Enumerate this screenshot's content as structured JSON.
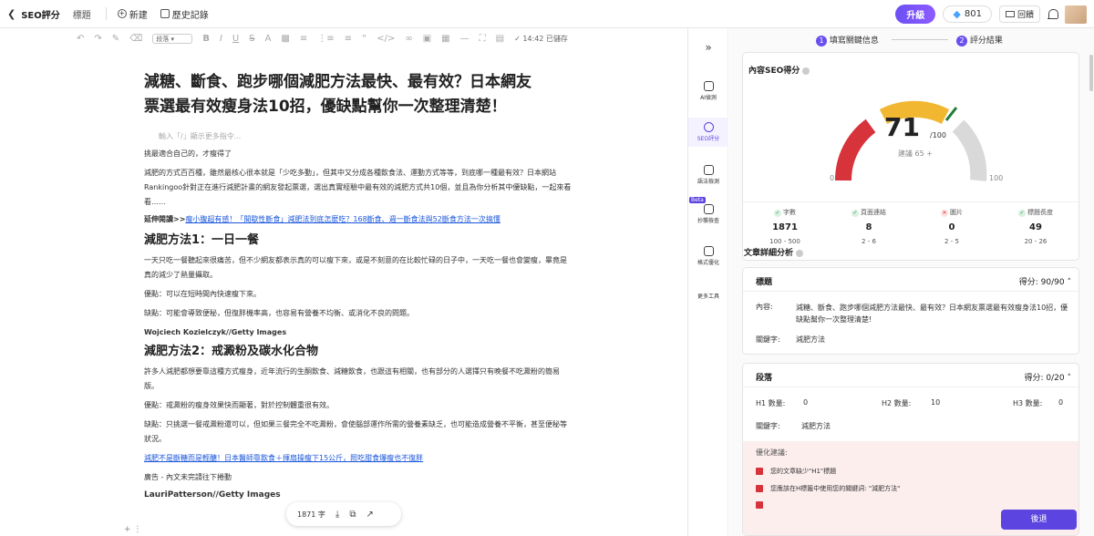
{
  "topbar": {
    "seo_label": "SEO評分",
    "title_label": "標題",
    "new_label": "新建",
    "history_label": "歷史記錄",
    "upgrade_label": "升級",
    "points": "801",
    "reply_label": "回饋"
  },
  "toolbar": {
    "paragraph_label": "段落",
    "saved_label": "14:42 已儲存"
  },
  "doc": {
    "title": "減糖、斷食、跑步哪個減肥方法最快、最有效？日本網友票選最有效瘦身法10招，優缺點幫你一次整理清楚！",
    "command_placeholder": "輸入「/」顯示更多指令...",
    "p1": "挑最適合自己的，才瘦得了",
    "p2": "減肥的方式百百種，雖然最核心很本就是「少吃多動」，但其中又分成各種飲食法、運動方式等等，到底哪一種最有效？日本網站Rankingoo針對正在進行減肥計畫的網友發起票選，選出真實經驗中最有效的減肥方式共10個，並且為你分析其中優缺點，一起來看看……",
    "ext_prefix": "延伸閱讀>>",
    "ext_link": "瘦小腹超有感！「間歇性斷食」減肥法到底怎麼吃？168斷食、週一斷食法與52斷食方法一次搞懂",
    "h2a": "減肥方法1：一日一餐",
    "p3": "一天只吃一餐聽起來很痛苦，但不少網友都表示真的可以瘦下來，或是不刻意的在比較忙碌的日子中，一天吃一餐也會變瘦，畢竟是真的減少了熱量攝取。",
    "p4": "優點：可以在短時間內快速瘦下來。",
    "p5": "缺點：可能會導致便秘，但復胖機率高，也容易有營養不均衡、或消化不良的問題。",
    "credit1": "Wojciech Kozielczyk//Getty Images",
    "h2b": "減肥方法2：戒澱粉及碳水化合物",
    "p6": "許多人減肥都想要靠這種方式瘦身，近年流行的生酮飲食、減糖飲食，也跟這有相關，也有部分的人選擇只有晚餐不吃澱粉的簡易版。",
    "p7": "優點：戒澱粉的瘦身效果快而顯著，對於控制體重很有效。",
    "p8": "缺點：只挑選一餐戒澱粉還可以，但如果三餐完全不吃澱粉，會使腦部運作所需的營養素缺乏，也可能造成營養不平衡，甚至便秘等狀況。",
    "link2": "減肥不是斷糖而是輕醣！日本醫師靠飲食＋揮扇操瘦下15公斤，照吃甜食爆瘦也不復胖",
    "ad_note": "廣告 - 內文未完請往下捲動",
    "credit2": "LauriPatterson//Getty Images",
    "word_count": "1871 字"
  },
  "sidebar": {
    "items": [
      {
        "label": "AI偵測"
      },
      {
        "label": "SEO評分"
      },
      {
        "label": "語法檢測"
      },
      {
        "label": "抄襲檢查"
      },
      {
        "label": "格式優化"
      },
      {
        "label": "更多工具"
      }
    ],
    "beta_label": "Beta"
  },
  "panel": {
    "step1_num": "1",
    "step1_label": "填寫關鍵信息",
    "step2_num": "2",
    "step2_label": "評分結果",
    "score_title": "內容SEO得分",
    "score": "71",
    "score_max": "/100",
    "suggest": "建議 65 +",
    "gauge_min": "0",
    "gauge_max": "100",
    "stats": [
      {
        "label": "字數",
        "value": "1871",
        "range": "100 - 500",
        "status": "ok"
      },
      {
        "label": "頁面連結",
        "value": "8",
        "range": "2 - 6",
        "status": "ok"
      },
      {
        "label": "圖片",
        "value": "0",
        "range": "2 - 5",
        "status": "fail"
      },
      {
        "label": "標題長度",
        "value": "49",
        "range": "20 - 26",
        "status": "ok"
      }
    ],
    "detail_title": "文章詳細分析",
    "title_card": {
      "name": "標題",
      "score": "得分: 90/90",
      "content_label": "內容:",
      "content_value": "減糖、斷食、跑步哪個減肥方法最快、最有效？日本網友票選最有效瘦身法10招，優缺點幫你一次整理清楚!",
      "keyword_label": "關鍵字:",
      "keyword_value": "減肥方法"
    },
    "para_card": {
      "name": "段落",
      "score": "得分: 0/20",
      "h1_label": "H1 數量:",
      "h1_value": "0",
      "h2_label": "H2 數量:",
      "h2_value": "10",
      "h3_label": "H3 數量:",
      "h3_value": "0",
      "keyword_label": "關鍵字:",
      "keyword_value": "減肥方法",
      "suggestion_title": "優化建議:",
      "suggestions": [
        "您的文章缺少\"H1\"標題",
        "您應該在H標籤中使用您的關鍵詞: \"減肥方法\""
      ]
    },
    "back_label": "後退"
  },
  "colors": {
    "accent": "#5b44e0",
    "gauge_red": "#d6333b",
    "gauge_yellow": "#f2b731",
    "gauge_gray": "#d9d9d9"
  }
}
